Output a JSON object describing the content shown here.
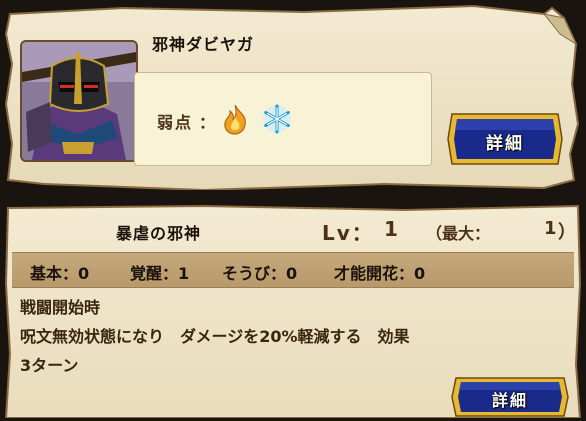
{
  "monster": {
    "name": "邪神ダビヤガ",
    "weakness_label": "弱点",
    "weakness_colon": "：",
    "weaknesses": [
      "fire-icon",
      "ice-icon"
    ]
  },
  "skill": {
    "name": "暴虐の邪神",
    "lv_label": "Lv：",
    "lv_value": "1",
    "max_label": "（最大：",
    "max_value": "1",
    "max_close": "）"
  },
  "stats": {
    "basic": "基本：0",
    "awaken": "覚醒：1",
    "equip": "そうび：0",
    "talent": "才能開花：0"
  },
  "description": {
    "line1": "戦闘開始時",
    "line2": "呪文無効状態になり　ダメージを20%軽減する　効果",
    "line3": "3ターン"
  },
  "buttons": {
    "detail_top": "詳細",
    "detail_bottom": "詳細"
  },
  "colors": {
    "parchment": "#f0e6cc",
    "parchment_edge": "#d9c8a0",
    "button_blue": "#1a2a8a",
    "button_gold": "#e8b830"
  }
}
